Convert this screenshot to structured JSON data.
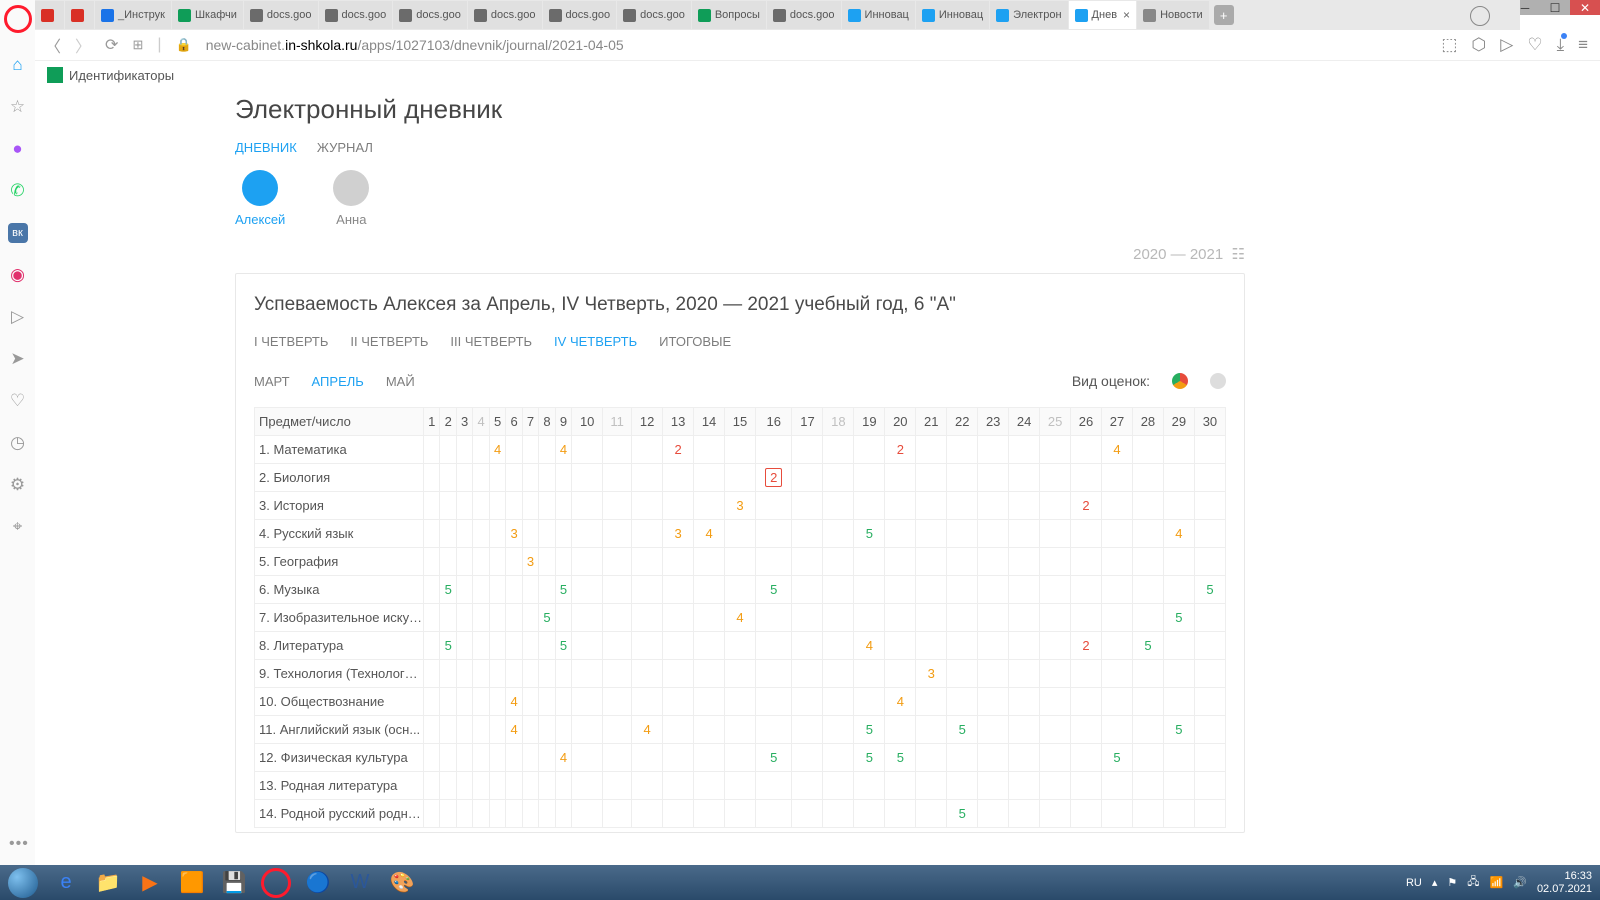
{
  "tabs": [
    {
      "label": "",
      "icon": "#d93025"
    },
    {
      "label": "",
      "icon": "#d93025"
    },
    {
      "label": "_Инструк",
      "icon": "#1a73e8"
    },
    {
      "label": "Шкафчи",
      "icon": "#0f9d58"
    },
    {
      "label": "docs.goo",
      "icon": "#6b6b6b"
    },
    {
      "label": "docs.goo",
      "icon": "#6b6b6b"
    },
    {
      "label": "docs.goo",
      "icon": "#6b6b6b"
    },
    {
      "label": "docs.goo",
      "icon": "#6b6b6b"
    },
    {
      "label": "docs.goo",
      "icon": "#6b6b6b"
    },
    {
      "label": "docs.goo",
      "icon": "#6b6b6b"
    },
    {
      "label": "Вопросы",
      "icon": "#0f9d58"
    },
    {
      "label": "docs.goo",
      "icon": "#6b6b6b"
    },
    {
      "label": "Инновац",
      "icon": "#1da1f2"
    },
    {
      "label": "Инновац",
      "icon": "#1da1f2"
    },
    {
      "label": "Электрон",
      "icon": "#1da1f2"
    },
    {
      "label": "Днев",
      "icon": "#1da1f2",
      "active": true
    },
    {
      "label": "Новости",
      "icon": "#888"
    }
  ],
  "url": {
    "domain": "new-cabinet.in-shkola.ru",
    "path": "/apps/1027103/dnevnik/journal/2021-04-05"
  },
  "bookmark": "Идентификаторы",
  "page": {
    "title": "Электронный дневник",
    "nav": {
      "diary": "ДНЕВНИК",
      "journal": "ЖУРНАЛ"
    },
    "students": [
      {
        "name": "Алексей",
        "active": true
      },
      {
        "name": "Анна"
      }
    ],
    "year": "2020 — 2021",
    "card_title": "Успеваемость Алексея за Апрель, IV Четверть, 2020 — 2021 учебный год, 6 \"А\"",
    "quarters": [
      "I ЧЕТВЕРТЬ",
      "II ЧЕТВЕРТЬ",
      "III ЧЕТВЕРТЬ",
      "IV ЧЕТВЕРТЬ",
      "ИТОГОВЫЕ"
    ],
    "quarter_active": 3,
    "months": [
      "МАРТ",
      "АПРЕЛЬ",
      "МАЙ"
    ],
    "month_active": 1,
    "grades_label": "Вид оценок:",
    "header_subject": "Предмет/число",
    "days": [
      1,
      2,
      3,
      4,
      5,
      6,
      7,
      8,
      9,
      10,
      11,
      12,
      13,
      14,
      15,
      16,
      17,
      18,
      19,
      20,
      21,
      22,
      23,
      24,
      25,
      26,
      27,
      28,
      29,
      30
    ],
    "dim_days": [
      4,
      11,
      18,
      25
    ],
    "subjects": [
      {
        "n": "1. Математика",
        "g": {
          "5": 4,
          "9": 4,
          "13": 2,
          "20": 2,
          "27": 4
        }
      },
      {
        "n": "2. Биология",
        "g": {
          "16": "2box"
        }
      },
      {
        "n": "3. История",
        "g": {
          "15": 3,
          "26": 2
        }
      },
      {
        "n": "4. Русский язык",
        "g": {
          "6": 3,
          "13": 3,
          "14": 4,
          "19": 5,
          "29": 4
        }
      },
      {
        "n": "5. География",
        "g": {
          "7": 3
        }
      },
      {
        "n": "6. Музыка",
        "g": {
          "2": 5,
          "9": 5,
          "16": 5,
          "30": 5
        }
      },
      {
        "n": "7. Изобразительное искус...",
        "g": {
          "8": 5,
          "15": 4,
          "29": 5
        }
      },
      {
        "n": "8. Литература",
        "g": {
          "2": 5,
          "9": 5,
          "19": 4,
          "26": 2,
          "28": 5
        }
      },
      {
        "n": "9. Технология (Технология...",
        "g": {
          "21": 3
        }
      },
      {
        "n": "10. Обществознание",
        "g": {
          "6": 4,
          "20": 4
        }
      },
      {
        "n": "11. Английский язык (осн...",
        "g": {
          "6": 4,
          "12": 4,
          "19": 5,
          "22": 5,
          "29": 5
        }
      },
      {
        "n": "12. Физическая культура",
        "g": {
          "9": 4,
          "16": 5,
          "19": 5,
          "20": 5,
          "27": 5
        }
      },
      {
        "n": "13. Родная литература",
        "g": {}
      },
      {
        "n": "14. Родной русский родна...",
        "g": {
          "22": 5
        }
      }
    ]
  },
  "tray": {
    "lang": "RU",
    "time": "16:33",
    "date": "02.07.2021"
  }
}
